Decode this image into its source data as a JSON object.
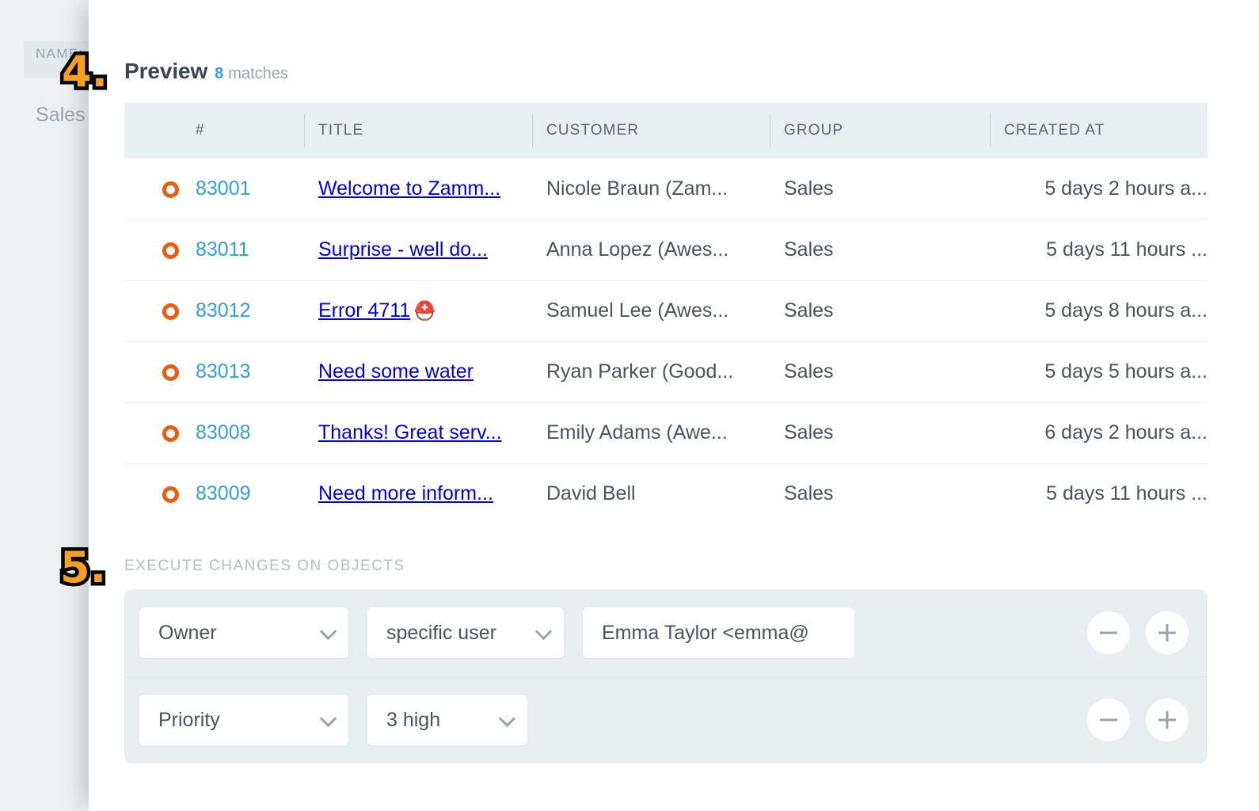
{
  "background": {
    "column_header": "NAME",
    "row_value": "Sales"
  },
  "annotations": [
    {
      "id": "badge-4",
      "label": "4."
    },
    {
      "id": "badge-5",
      "label": "5."
    }
  ],
  "preview": {
    "title": "Preview",
    "count": "8",
    "count_label": "matches",
    "columns": [
      {
        "key": "state",
        "label": ""
      },
      {
        "key": "number",
        "label": "#"
      },
      {
        "key": "title",
        "label": "TITLE"
      },
      {
        "key": "customer",
        "label": "CUSTOMER"
      },
      {
        "key": "group",
        "label": "GROUP"
      },
      {
        "key": "created_at",
        "label": "CREATED AT"
      }
    ],
    "rows": [
      {
        "state_icon": "open-ticket-icon",
        "number": "83001",
        "title": "Welcome to Zamm...",
        "emoji": "",
        "customer": "Nicole Braun (Zam...",
        "group": "Sales",
        "created_at": "5 days 2 hours a..."
      },
      {
        "state_icon": "open-ticket-icon",
        "number": "83011",
        "title": "Surprise - well do...",
        "emoji": "",
        "customer": "Anna Lopez (Awes...",
        "group": "Sales",
        "created_at": "5 days 11 hours ..."
      },
      {
        "state_icon": "open-ticket-icon",
        "number": "83012",
        "title": "Error 4711",
        "emoji": "⛑️",
        "customer": "Samuel Lee (Awes...",
        "group": "Sales",
        "created_at": "5 days 8 hours a..."
      },
      {
        "state_icon": "open-ticket-icon",
        "number": "83013",
        "title": "Need some water",
        "emoji": "",
        "customer": "Ryan Parker (Good...",
        "group": "Sales",
        "created_at": "5 days 5 hours a..."
      },
      {
        "state_icon": "open-ticket-icon",
        "number": "83008",
        "title": "Thanks! Great serv...",
        "emoji": "",
        "customer": "Emily Adams (Awe...",
        "group": "Sales",
        "created_at": "6 days 2 hours a..."
      },
      {
        "state_icon": "open-ticket-icon",
        "number": "83009",
        "title": "Need more inform...",
        "emoji": "",
        "customer": "David Bell",
        "group": "Sales",
        "created_at": "5 days 11 hours ..."
      }
    ]
  },
  "execute_changes": {
    "label": "EXECUTE CHANGES ON OBJECTS",
    "rows": [
      {
        "attribute": "Owner",
        "operator": "specific user",
        "value": "Emma Taylor <emma@",
        "remove_icon": "minus-icon",
        "add_icon": "plus-icon"
      },
      {
        "attribute": "Priority",
        "operator": "3 high",
        "value": "",
        "remove_icon": "minus-icon",
        "add_icon": "plus-icon"
      }
    ]
  },
  "colors": {
    "link": "#2fa0dd",
    "state_open": "#ec5c0d",
    "panel_bg": "#e8edf0",
    "table_header_bg": "#e9eef1",
    "annotation": "#F5A020"
  }
}
